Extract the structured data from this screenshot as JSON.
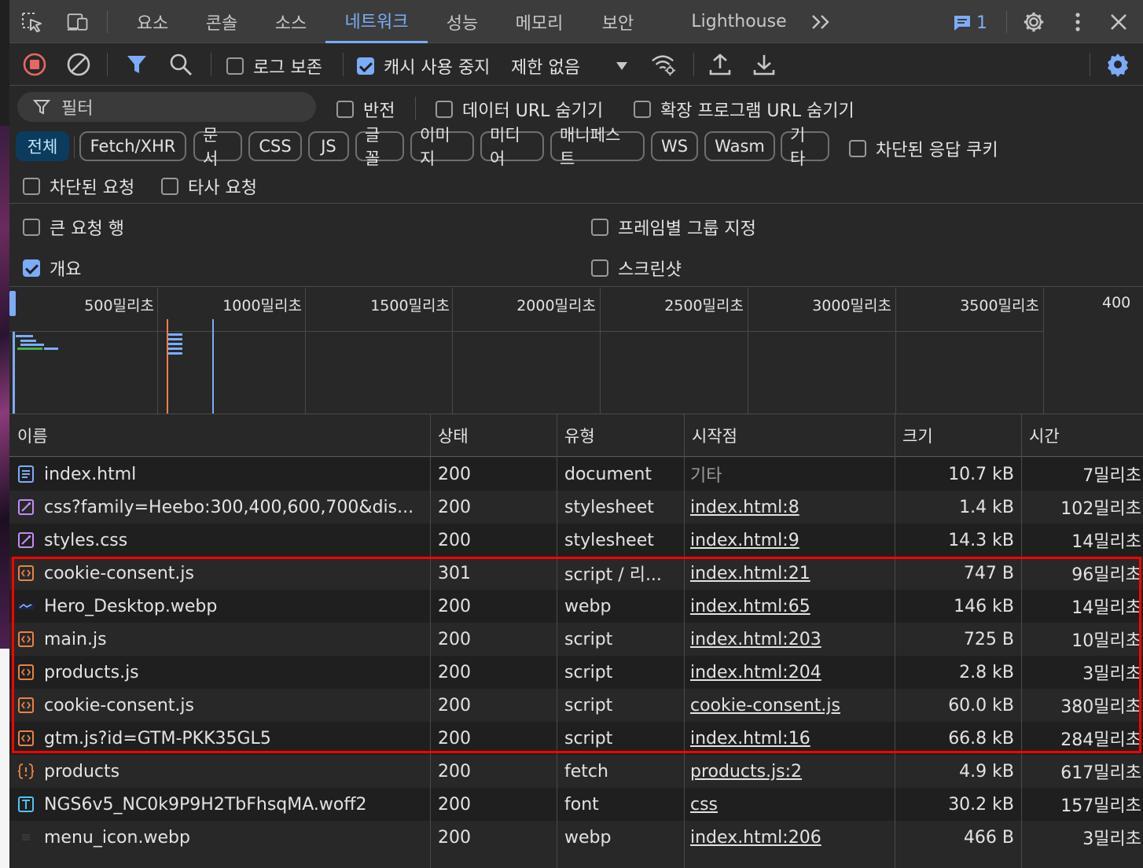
{
  "tabs": [
    {
      "label": "요소",
      "active": false
    },
    {
      "label": "콘솔",
      "active": false
    },
    {
      "label": "소스",
      "active": false
    },
    {
      "label": "네트워크",
      "active": true
    },
    {
      "label": "성능",
      "active": false
    },
    {
      "label": "메모리",
      "active": false
    },
    {
      "label": "보안",
      "active": false
    },
    {
      "label": "Lighthouse",
      "active": false
    }
  ],
  "issues_count": "1",
  "toolbar": {
    "preserve_log_label": "로그 보존",
    "preserve_log_checked": false,
    "disable_cache_label": "캐시 사용 중지",
    "disable_cache_checked": true,
    "throttling_value": "제한 없음"
  },
  "filter": {
    "placeholder": "필터",
    "invert_label": "반전",
    "hide_data_urls_label": "데이터 URL 숨기기",
    "hide_extension_urls_label": "확장 프로그램 URL 숨기기",
    "type_chips": [
      "전체",
      "Fetch/XHR",
      "문서",
      "CSS",
      "JS",
      "글꼴",
      "이미지",
      "미디어",
      "매니페스트",
      "WS",
      "Wasm",
      "기타"
    ],
    "active_chip": "전체",
    "blocked_cookies_label": "차단된 응답 쿠키",
    "blocked_requests_label": "차단된 요청",
    "third_party_label": "타사 요청"
  },
  "settings": {
    "big_rows_label": "큰 요청 행",
    "big_rows_checked": false,
    "overview_label": "개요",
    "overview_checked": true,
    "group_by_frame_label": "프레임별 그룹 지정",
    "group_by_frame_checked": false,
    "screenshots_label": "스크린샷",
    "screenshots_checked": false
  },
  "overview": {
    "ticks": [
      "500밀리초",
      "1000밀리초",
      "1500밀리초",
      "2000밀리초",
      "2500밀리초",
      "3000밀리초",
      "3500밀리초",
      "400"
    ]
  },
  "table": {
    "headers": {
      "name": "이름",
      "status": "상태",
      "type": "유형",
      "initiator": "시작점",
      "size": "크기",
      "time": "시간"
    },
    "rows": [
      {
        "icon": "document-icon",
        "name": "index.html",
        "status": "200",
        "type": "document",
        "initiator": "기타",
        "initiator_link": false,
        "size": "10.7 kB",
        "time": "7밀리초"
      },
      {
        "icon": "stylesheet-icon",
        "name": "css?family=Heebo:300,400,600,700&dis...",
        "status": "200",
        "type": "stylesheet",
        "initiator": "index.html:8",
        "initiator_link": true,
        "size": "1.4 kB",
        "time": "102밀리초"
      },
      {
        "icon": "stylesheet-icon",
        "name": "styles.css",
        "status": "200",
        "type": "stylesheet",
        "initiator": "index.html:9",
        "initiator_link": true,
        "size": "14.3 kB",
        "time": "14밀리초"
      },
      {
        "icon": "script-icon",
        "name": "cookie-consent.js",
        "status": "301",
        "type": "script / 리...",
        "initiator": "index.html:21",
        "initiator_link": true,
        "size": "747 B",
        "time": "96밀리초"
      },
      {
        "icon": "image-thumbnail-icon",
        "name": "Hero_Desktop.webp",
        "status": "200",
        "type": "webp",
        "initiator": "index.html:65",
        "initiator_link": true,
        "size": "146 kB",
        "time": "14밀리초"
      },
      {
        "icon": "script-icon",
        "name": "main.js",
        "status": "200",
        "type": "script",
        "initiator": "index.html:203",
        "initiator_link": true,
        "size": "725 B",
        "time": "10밀리초"
      },
      {
        "icon": "script-icon",
        "name": "products.js",
        "status": "200",
        "type": "script",
        "initiator": "index.html:204",
        "initiator_link": true,
        "size": "2.8 kB",
        "time": "3밀리초"
      },
      {
        "icon": "script-icon",
        "name": "cookie-consent.js",
        "status": "200",
        "type": "script",
        "initiator": "cookie-consent.js",
        "initiator_link": true,
        "size": "60.0 kB",
        "time": "380밀리초"
      },
      {
        "icon": "script-icon",
        "name": "gtm.js?id=GTM-PKK35GL5",
        "status": "200",
        "type": "script",
        "initiator": "index.html:16",
        "initiator_link": true,
        "size": "66.8 kB",
        "time": "284밀리초"
      },
      {
        "icon": "fetch-icon",
        "name": "products",
        "status": "200",
        "type": "fetch",
        "initiator": "products.js:2",
        "initiator_link": true,
        "size": "4.9 kB",
        "time": "617밀리초"
      },
      {
        "icon": "font-icon",
        "name": "NGS6v5_NC0k9P9H2TbFhsqMA.woff2",
        "status": "200",
        "type": "font",
        "initiator": "css",
        "initiator_link": true,
        "size": "30.2 kB",
        "time": "157밀리초"
      },
      {
        "icon": "menu-thumbnail-icon",
        "name": "menu_icon.webp",
        "status": "200",
        "type": "webp",
        "initiator": "index.html:206",
        "initiator_link": true,
        "size": "466 B",
        "time": "3밀리초"
      }
    ]
  },
  "colors": {
    "accent": "#7cacf8",
    "highlight": "#ff0000",
    "active_chip_bg": "#0b3c5d"
  }
}
